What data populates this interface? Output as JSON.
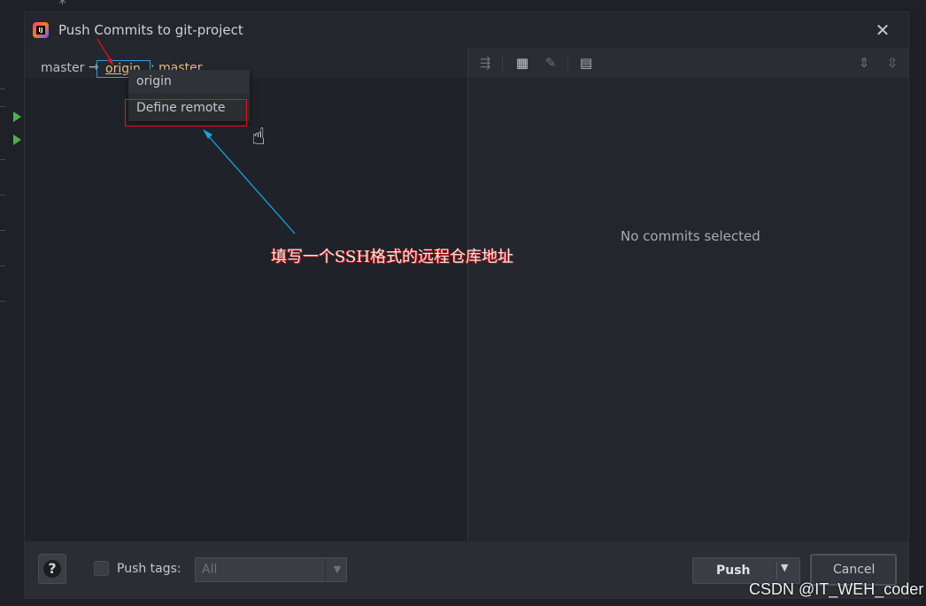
{
  "window": {
    "title": "Push Commits to git-project",
    "close_glyph": "✕"
  },
  "branch_row": {
    "local": "master",
    "arrow": "→",
    "remote": "origin",
    "remote_branch": ": master"
  },
  "remote_menu": {
    "items": [
      "origin",
      "Define remote"
    ]
  },
  "right_panel": {
    "empty_text": "No commits selected",
    "toolbar_icons": [
      "cherry-pick-icon",
      "group-by-icon",
      "edit-icon",
      "preview-icon",
      "expand-all-icon",
      "collapse-all-icon"
    ]
  },
  "annotation": {
    "text": "填写一个SSH格式的远程仓库地址"
  },
  "bottom": {
    "help": "?",
    "push_tags_label": "Push tags:",
    "push_tags_value": "All",
    "push_label": "Push",
    "cancel_label": "Cancel"
  },
  "watermark": "CSDN @IT_WEH_coder",
  "colors": {
    "remote_accent": "#e5c07b",
    "highlight_border": "#2aa0d8",
    "annotation_red": "#e0141e",
    "annotation_arrow": "#1aa0e0"
  }
}
